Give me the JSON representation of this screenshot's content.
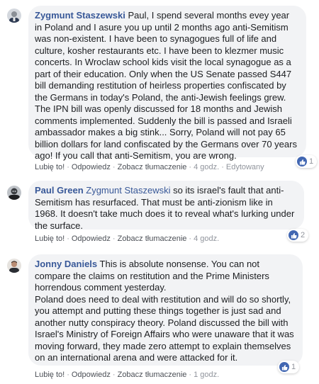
{
  "actions": {
    "like": "Lubię to!",
    "reply": "Odpowiedz",
    "translate": "Zobacz tłumaczenie",
    "separator": "·"
  },
  "comments": [
    {
      "author": "Zygmunt Staszewski",
      "mention": "",
      "text": "Paul, I spend several months evey year in Poland and I asure you up until 2 months ago anti-Semitism was non-existent. I have been to synagogues full of life and culture, kosher restaurants etc. I have been to klezmer music concerts. In Wroclaw school kids visit the local synagogue as a part of their education. Only when the US Senate passed S447 bill demanding restitution of heirless properties confiscated by the Germans in today's Poland, the anti-Jewish feelings grew. The IPN bill was openly discussed for 18 months and Jewish comments implemented. Suddenly the bill is passed and Israeli ambassador makes a big stink... Sorry, Poland will not pay 65 billion dollars for land confiscated by the Germans over 70 years ago! If you call that anti-Semitism, you are wrong.",
      "time": "4 godz.",
      "edited": "Edytowany",
      "likes": "1",
      "avatar_icon": "user-avatar-icon"
    },
    {
      "author": "Paul Green",
      "mention": "Zygmunt Staszewski",
      "text": "so its israel's fault that anti-Semitism has resurfaced. That must be anti-zionism like in 1968. It doesn't take much does it to reveal what's lurking under the surface.",
      "time": "4 godz.",
      "edited": "",
      "likes": "2",
      "avatar_icon": "user-avatar-icon"
    },
    {
      "author": "Jonny Daniels",
      "mention": "",
      "text": "This is absolute nonsense. You can not compare the claims on restitution and the Prime Ministers horrendous comment yesterday.\nPoland does need to deal with restitution and will do so shortly, you attempt and putting these things together is just sad and another nutty conspiracy theory. Poland discussed the bill with Israel's Ministry of Foreign Affairs who were unaware that it was moving forward, they made zero attempt to explain themselves on an international arena and were attacked for it.",
      "time": "1 godz.",
      "edited": "",
      "likes": "1",
      "avatar_icon": "user-avatar-icon"
    }
  ],
  "colors": {
    "link": "#385898",
    "bubble": "#f2f3f5",
    "like_badge": "#4267b2",
    "meta": "#90949c"
  }
}
